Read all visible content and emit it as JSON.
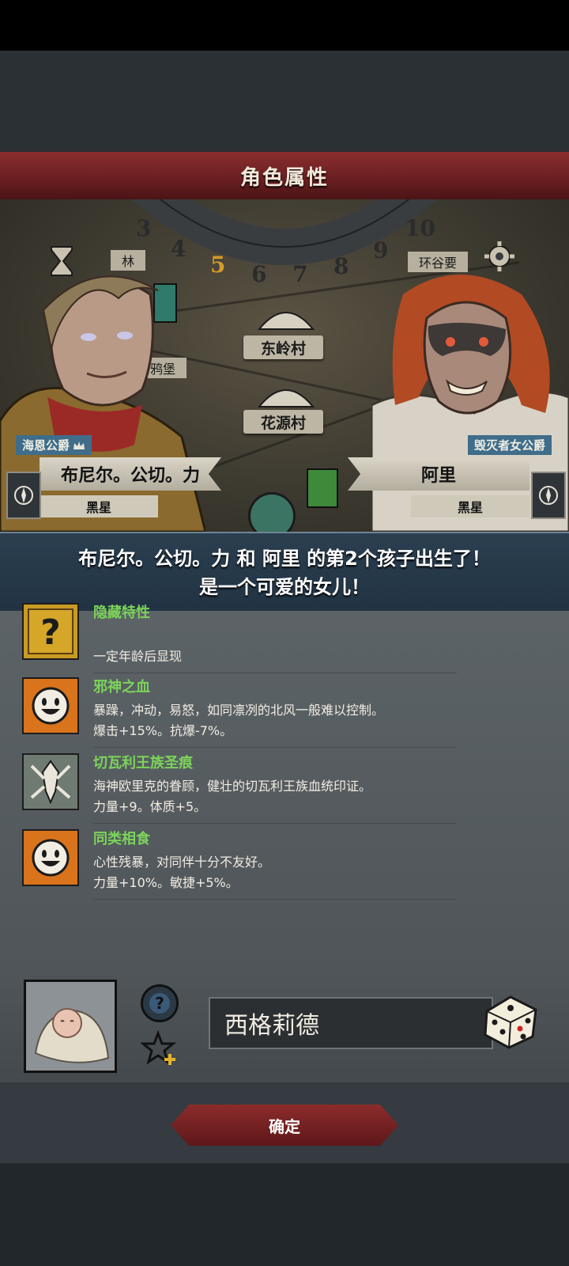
{
  "header": {
    "title": "角色属性"
  },
  "map": {
    "dial_numbers": [
      "3",
      "4",
      "5",
      "6",
      "7",
      "8",
      "9",
      "10"
    ],
    "current_turn": "5",
    "towns": {
      "town_top_left": "林",
      "town_top_right": "环谷要",
      "town_center_1": "东岭村",
      "town_center_2": "花源村",
      "town_left": "鸦堡"
    }
  },
  "father": {
    "title": "海恩公爵",
    "name": "布尼尔。公切。力",
    "constellation": "黑星"
  },
  "mother": {
    "title": "毁灭者女公爵",
    "name": "阿里",
    "constellation": "黑星"
  },
  "announcement": {
    "line1": "布尼尔。公切。力 和 阿里 的第2个孩子出生了！",
    "line2": "是一个可爱的女儿！"
  },
  "traits": [
    {
      "name": "隐藏特性",
      "line1": "",
      "line2": "一定年龄后显现",
      "icon": "question-icon"
    },
    {
      "name": "邪神之血",
      "line1": "暴躁，冲动，易怒，如同凛冽的北风一般难以控制。",
      "line2": "爆击+15%。抗爆-7%。",
      "icon": "grin-face-icon"
    },
    {
      "name": "切瓦利王族圣痕",
      "line1": "海神欧里克的眷顾，健壮的切瓦利王族血统印证。",
      "line2": "力量+9。体质+5。",
      "icon": "crest-icon"
    },
    {
      "name": "同类相食",
      "line1": "心性残暴，对同伴十分不友好。",
      "line2": "力量+10%。敏捷+5%。",
      "icon": "grin-face-icon"
    }
  ],
  "child": {
    "name": "西格莉德"
  },
  "buttons": {
    "confirm": "确定"
  },
  "colors": {
    "trait_name": "#7cd35a",
    "title_bar": "#7a2528",
    "announce_bg": "#27394a"
  }
}
